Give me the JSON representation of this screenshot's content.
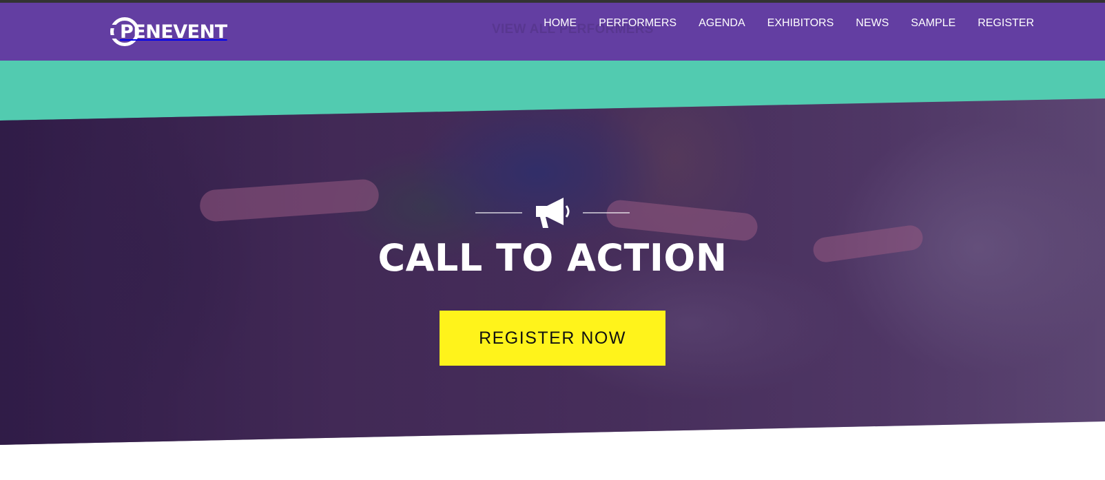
{
  "brand": {
    "logo_text": "PENEVENT",
    "logo_lettering": "OPENEVENT",
    "purple": "#633ea2",
    "teal": "#52cbb0",
    "accent_yellow": "#fff31b"
  },
  "header": {
    "ghost_link": "VIEW ALL PERFORMERS",
    "nav": [
      {
        "label": "HOME"
      },
      {
        "label": "PERFORMERS"
      },
      {
        "label": "AGENDA"
      },
      {
        "label": "EXHIBITORS"
      },
      {
        "label": "NEWS"
      },
      {
        "label": "SAMPLE"
      },
      {
        "label": "REGISTER"
      }
    ]
  },
  "hero": {
    "icon": "megaphone-icon",
    "title": "CALL TO ACTION",
    "button_label": "REGISTER NOW"
  }
}
